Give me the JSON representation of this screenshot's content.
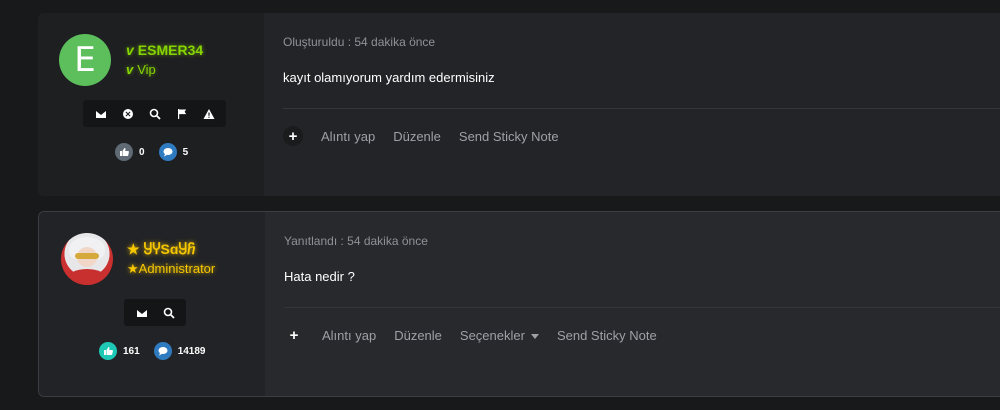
{
  "posts": [
    {
      "avatar_letter": "E",
      "avatar_color": "#5cbf5c",
      "username": "ESMER34",
      "user_title": "Vip",
      "name_color": "#86d400",
      "tools": [
        "envelope-icon",
        "block-icon",
        "search-icon",
        "flag-icon",
        "warning-icon"
      ],
      "likes": "0",
      "messages": "5",
      "meta": "Oluşturuldu : 54 dakika önce",
      "body": "kayıt olamıyorum yardım edermisiniz",
      "actions": [
        "Alıntı yap",
        "Düzenle",
        "Send Sticky Note"
      ]
    },
    {
      "username": "ႸჄЅɑႸⴌ",
      "user_title": "Administrator",
      "name_color": "#f6c700",
      "tools": [
        "envelope-icon",
        "search-icon"
      ],
      "likes": "161",
      "messages": "14189",
      "meta": "Yanıtlandı : 54 dakika önce",
      "body": "Hata nedir ?",
      "actions": [
        "Alıntı yap",
        "Düzenle",
        "Seçenekler",
        "Send Sticky Note"
      ]
    }
  ],
  "icons": {
    "plus": "+",
    "like_color_post1": "#5f6a75",
    "msg_color_post1": "#2f7bc0",
    "like_color_post2": "#1ec8b4",
    "msg_color_post2": "#2f7bc0"
  }
}
